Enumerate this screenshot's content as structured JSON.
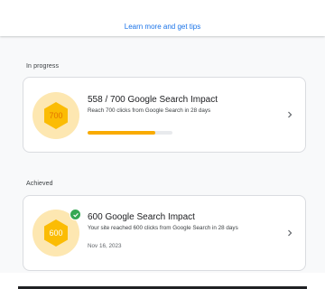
{
  "top_link": "Learn more and get tips",
  "colors": {
    "link": "#1a73e8",
    "badge_circle": "#fde7b1",
    "badge_hex": "#fbbc04",
    "badge_text": "#e37400",
    "progress_fill": "#f9ab00",
    "check": "#34a853"
  },
  "in_progress": {
    "section_label": "In progress",
    "badge_value": "700",
    "title": "558 / 700 Google Search Impact",
    "subtitle": "Reach 700 clicks from Google Search in 28 days",
    "progress_fraction": 0.797,
    "chevron_icon": "chevron-right-icon"
  },
  "achieved": {
    "section_label": "Achieved",
    "badge_value": "600",
    "title": "600 Google Search Impact",
    "subtitle": "Your site reached 600 clicks from Google Search in 28 days",
    "date": "Nov 16, 2023",
    "check_icon": "check-circle-icon",
    "chevron_icon": "chevron-right-icon"
  }
}
